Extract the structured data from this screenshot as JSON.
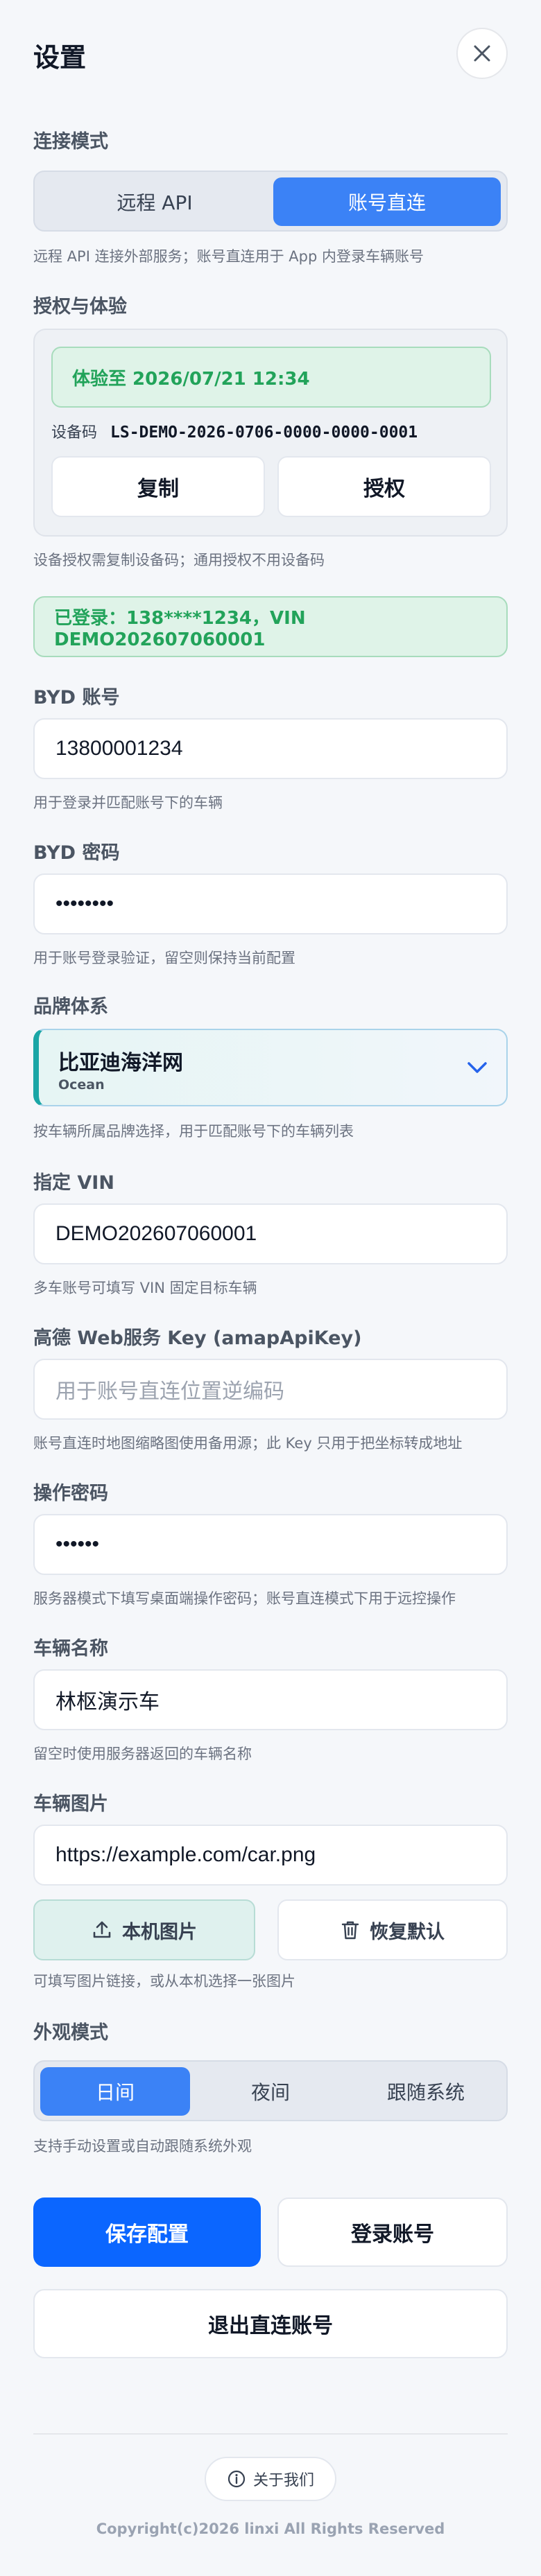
{
  "header": {
    "title": "设置",
    "close_icon": "close-icon"
  },
  "connection": {
    "label": "连接模式",
    "options": [
      "远程 API",
      "账号直连"
    ],
    "selected": "账号直连",
    "hint": "远程 API 连接外部服务；账号直连用于 App 内登录车辆账号"
  },
  "auth": {
    "label": "授权与体验",
    "trial_text": "体验至 2026/07/21 12:34",
    "device_label": "设备码",
    "device_code": "LS-DEMO-2026-0706-0000-0000-0001",
    "copy_label": "复制",
    "authorize_label": "授权",
    "hint": "设备授权需复制设备码；通用授权不用设备码"
  },
  "login_status": "已登录：138****1234，VIN DEMO202607060001",
  "byd_account": {
    "label": "BYD 账号",
    "value": "13800001234",
    "hint": "用于登录并匹配账号下的车辆"
  },
  "byd_password": {
    "label": "BYD 密码",
    "value": "••••••••",
    "hint": "用于账号登录验证，留空则保持当前配置"
  },
  "brand": {
    "label": "品牌体系",
    "name": "比亚迪海洋网",
    "sub": "Ocean",
    "hint": "按车辆所属品牌选择，用于匹配账号下的车辆列表"
  },
  "vin": {
    "label": "指定 VIN",
    "value": "DEMO202607060001",
    "hint": "多车账号可填写 VIN 固定目标车辆"
  },
  "amap": {
    "label": "高德 Web服务 Key (amapApiKey)",
    "placeholder": "用于账号直连位置逆编码",
    "hint": "账号直连时地图缩略图使用备用源；此 Key 只用于把坐标转成地址"
  },
  "op_password": {
    "label": "操作密码",
    "value": "••••••",
    "hint": "服务器模式下填写桌面端操作密码；账号直连模式下用于远控操作"
  },
  "vehicle_name": {
    "label": "车辆名称",
    "value": "林枢演示车",
    "hint": "留空时使用服务器返回的车辆名称"
  },
  "vehicle_image": {
    "label": "车辆图片",
    "value": "https://example.com/car.png",
    "upload_label": "本机图片",
    "reset_label": "恢复默认",
    "hint": "可填写图片链接，或从本机选择一张图片"
  },
  "appearance": {
    "label": "外观模式",
    "options": [
      "日间",
      "夜间",
      "跟随系统"
    ],
    "selected": "日间",
    "hint": "支持手动设置或自动跟随系统外观"
  },
  "actions": {
    "save": "保存配置",
    "login": "登录账号",
    "logout": "退出直连账号"
  },
  "footer": {
    "about": "关于我们",
    "copyright": "Copyright(c)2026 linxi All Rights Reserved"
  },
  "colors": {
    "primary": "#3b82f6",
    "save_button": "#0b66ff",
    "success": "#22a35a",
    "brand_accent": "#1aa6a6"
  }
}
